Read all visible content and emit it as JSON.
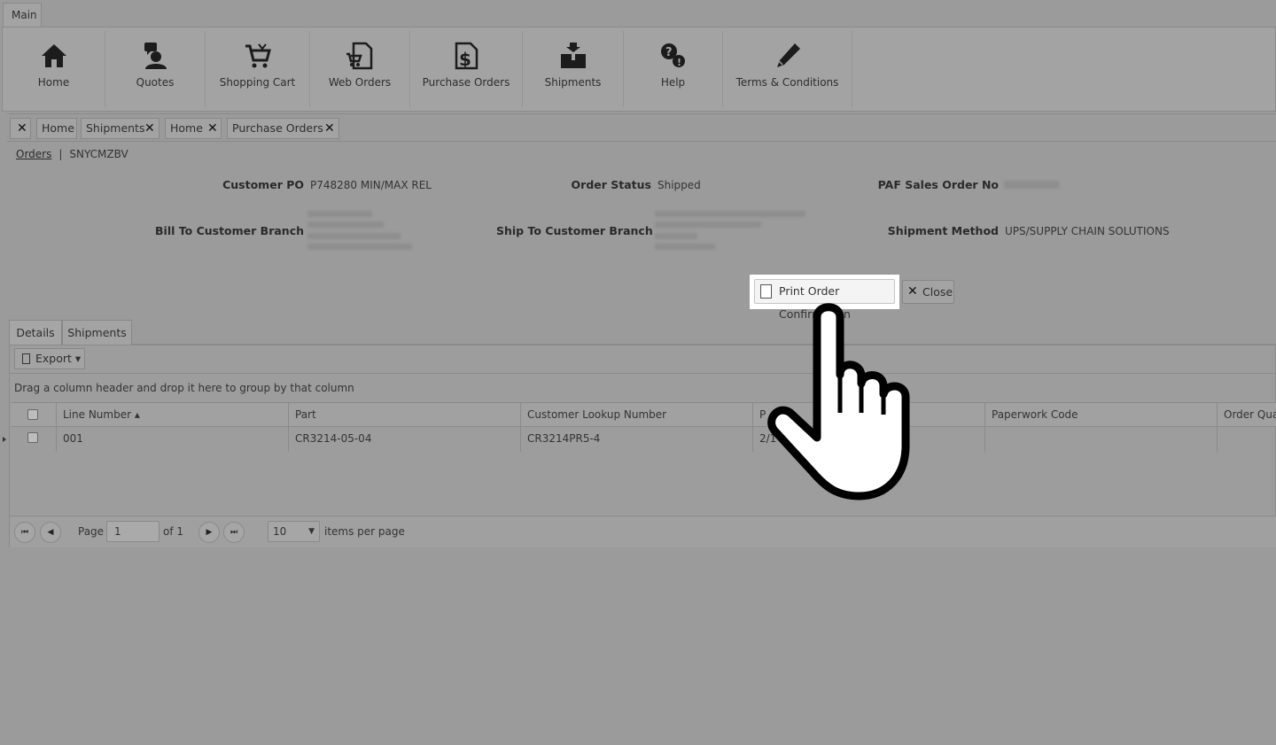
{
  "ribbon": {
    "tab_label": "Main",
    "buttons": [
      {
        "label": "Home",
        "icon": "home-icon"
      },
      {
        "label": "Quotes",
        "icon": "quotes-icon"
      },
      {
        "label": "Shopping Cart",
        "icon": "shopping-cart-icon"
      },
      {
        "label": "Web Orders",
        "icon": "web-orders-icon"
      },
      {
        "label": "Purchase Orders",
        "icon": "purchase-orders-icon"
      },
      {
        "label": "Shipments",
        "icon": "shipments-icon"
      },
      {
        "label": "Help",
        "icon": "help-icon"
      },
      {
        "label": "Terms & Conditions",
        "icon": "pen-icon"
      }
    ]
  },
  "doc_tabs": [
    "Home",
    "Shipments",
    "Home",
    "Purchase Orders"
  ],
  "breadcrumb": {
    "link": "Orders",
    "separator": "|",
    "current": "SNYCMZBV"
  },
  "order": {
    "customer_po_label": "Customer PO",
    "customer_po_value": "P748280 MIN/MAX REL",
    "order_status_label": "Order Status",
    "order_status_value": "Shipped",
    "paf_label": "PAF Sales Order No",
    "bill_to_label": "Bill To Customer Branch",
    "ship_to_label": "Ship To Customer Branch",
    "shipment_method_label": "Shipment Method",
    "shipment_method_value": "UPS/SUPPLY CHAIN SOLUTIONS"
  },
  "actions": {
    "print_label": "Print Order Confirmation",
    "close_label": "Close"
  },
  "detail_tabs": [
    "Details",
    "Shipments"
  ],
  "toolbar": {
    "export_label": "Export ▾"
  },
  "grid": {
    "group_hint": "Drag a column header and drop it here to group by that column",
    "columns": [
      "Line Number ▴",
      "Part",
      "Customer Lookup Number",
      "P",
      "",
      "Paperwork Code",
      "Order Quan"
    ],
    "rows": [
      {
        "line": "001",
        "part": "CR3214-05-04",
        "lookup": "CR3214PR5-4",
        "col4": "2/1",
        "col5": "",
        "paperwork": "",
        "qty": ""
      }
    ]
  },
  "pager": {
    "first": "⏮",
    "prev": "◀",
    "next": "▶",
    "last": "⏭",
    "page_label": "Page",
    "page_value": "1",
    "of_label": "of 1",
    "page_size": "10",
    "items_label": "items per page"
  },
  "colors": {
    "overlay_gray": "#9b9b9b",
    "highlight": "#ffffff"
  }
}
